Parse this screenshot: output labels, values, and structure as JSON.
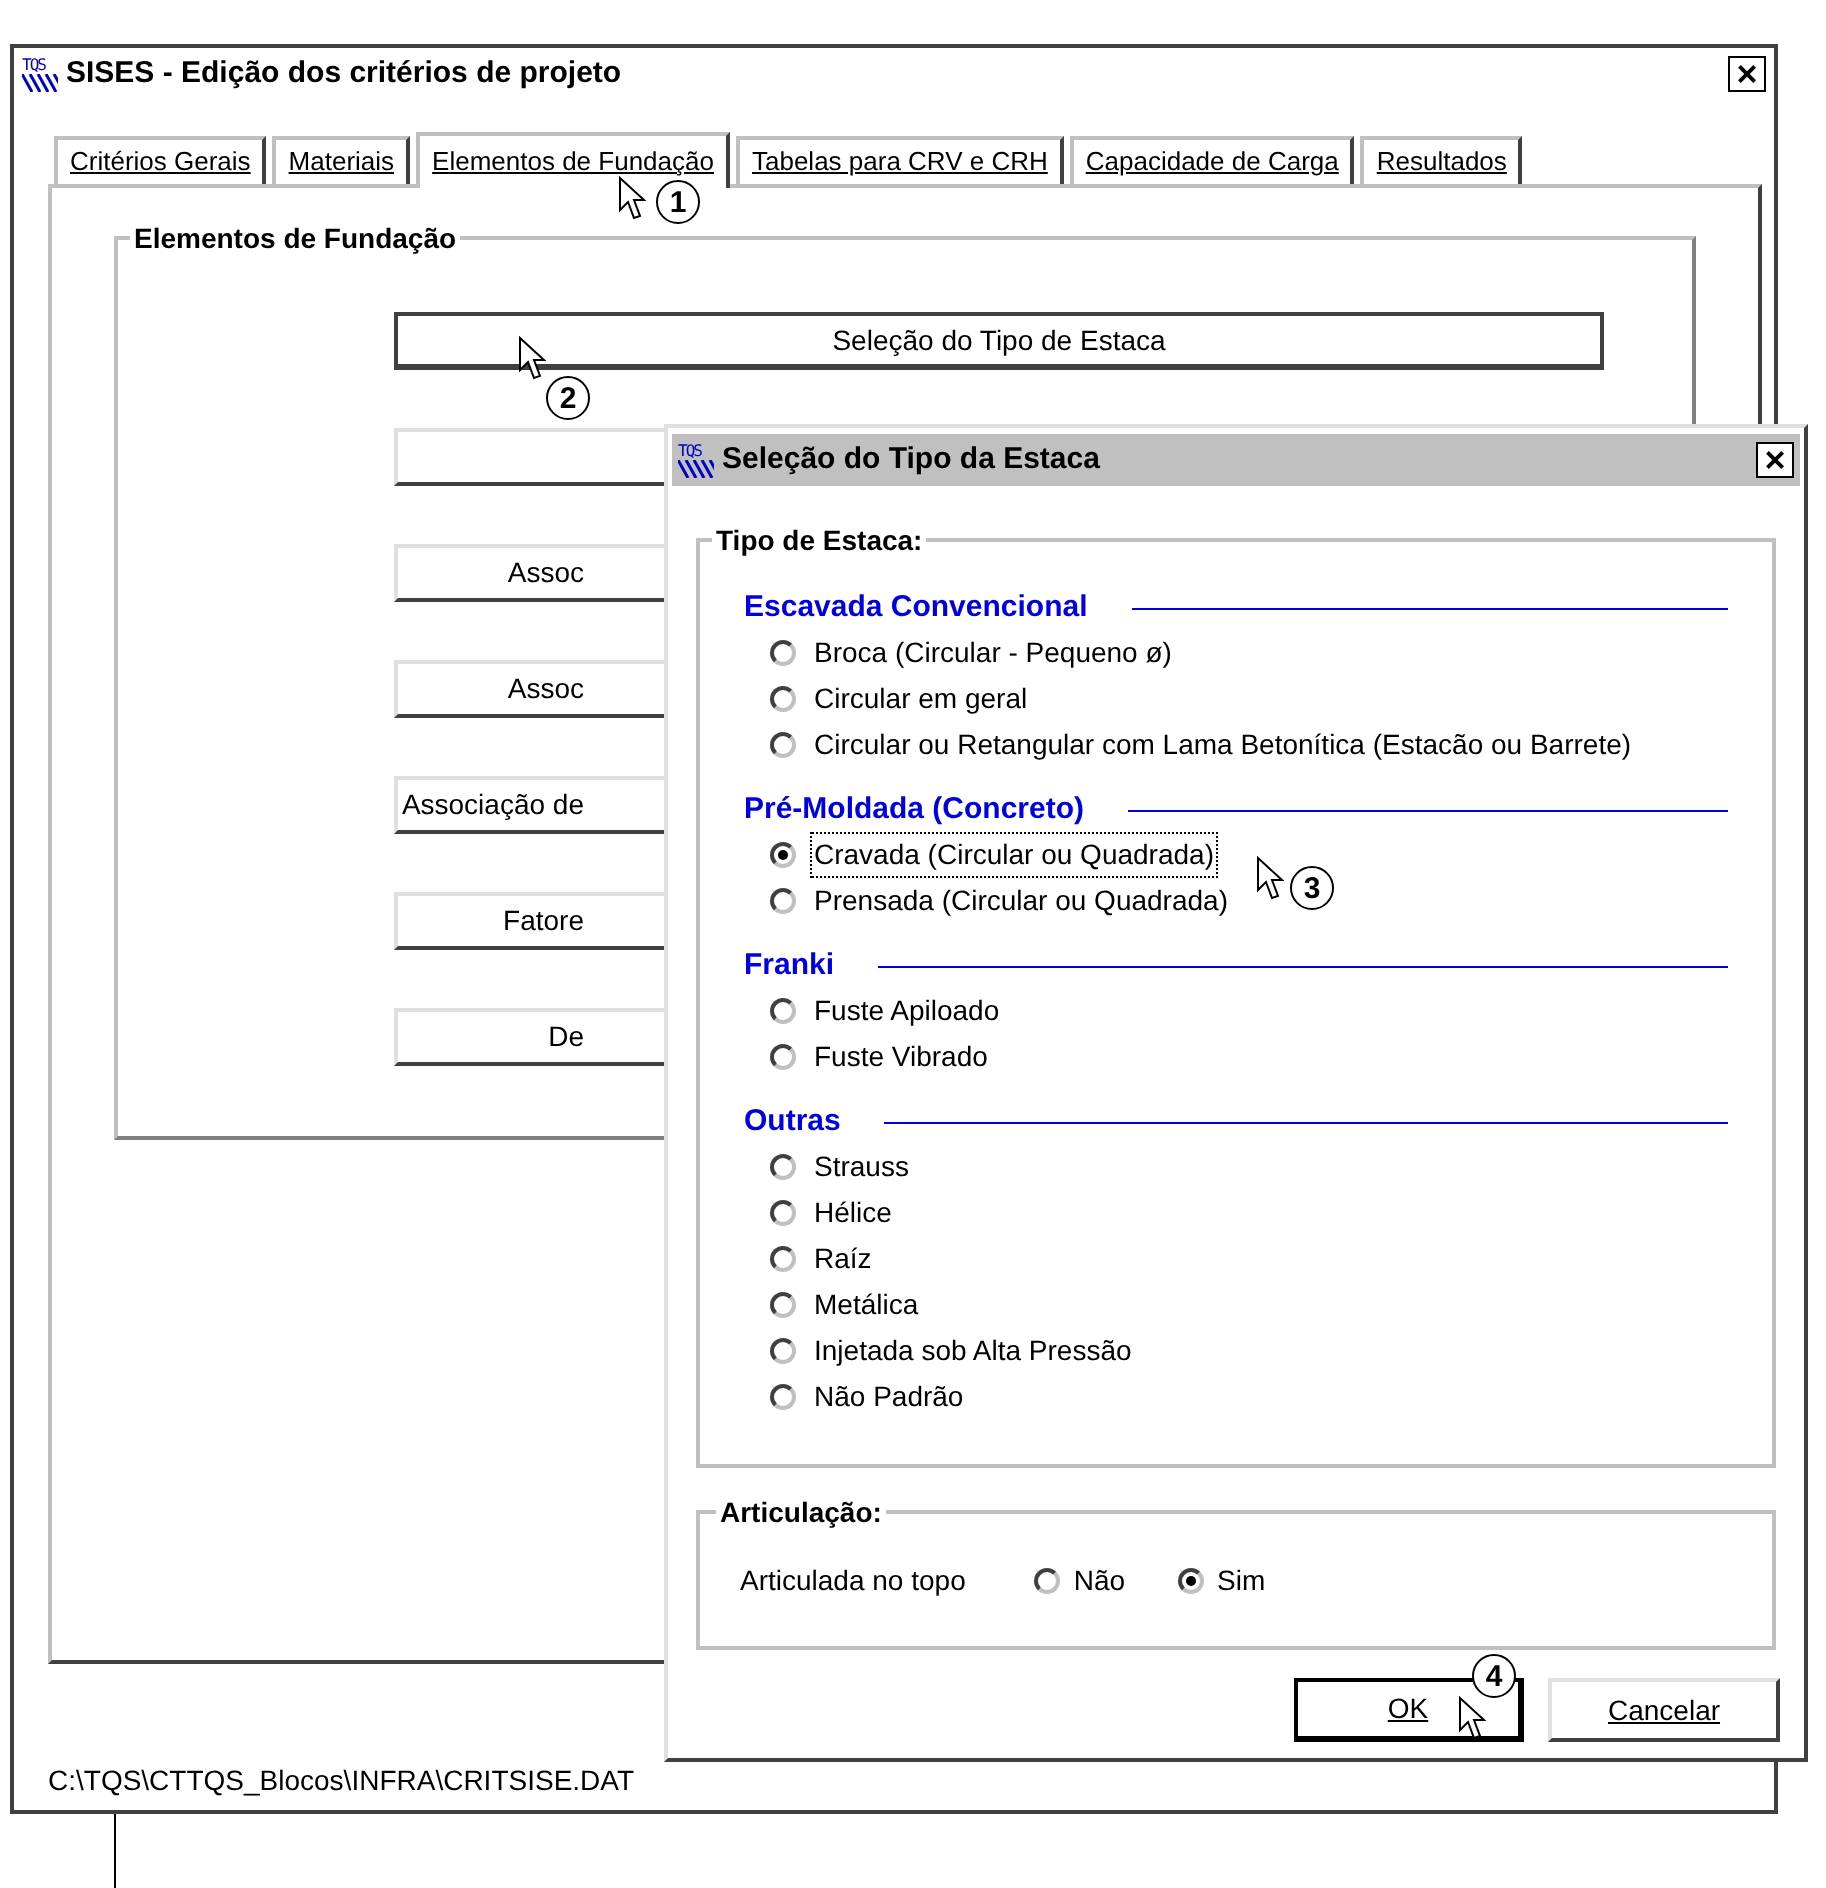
{
  "main_window": {
    "icon_text": "TQS",
    "title": "SISES - Edição dos critérios de projeto",
    "close": "×",
    "tabs": [
      {
        "label": "Critérios Gerais",
        "selected": false
      },
      {
        "label": "Materiais",
        "selected": false
      },
      {
        "label": "Elementos de Fundação",
        "selected": true
      },
      {
        "label": "Tabelas para CRV e CRH",
        "selected": false
      },
      {
        "label": "Capacidade de Carga",
        "selected": false
      },
      {
        "label": "Resultados",
        "selected": false
      }
    ],
    "group_title": "Elementos de Fundação",
    "buttons": [
      {
        "label": "Seleção do Tipo de Estaca",
        "default": true
      },
      {
        "default": false
      },
      {
        "label": "Assoc",
        "default": false
      },
      {
        "label": "Assoc",
        "default": false
      },
      {
        "label": "Associação de",
        "default": false
      },
      {
        "label": "Fatore",
        "default": false
      },
      {
        "label": "De",
        "default": false
      }
    ],
    "status_bar": "C:\\TQS\\CTTQS_Blocos\\INFRA\\CRITSISE.DAT"
  },
  "dialog": {
    "icon_text": "TQS",
    "title": "Seleção do Tipo da Estaca",
    "close": "×",
    "group_title": "Tipo de Estaca:",
    "sections": [
      {
        "heading": "Escavada Convencional",
        "options": [
          {
            "label": "Broca (Circular - Pequeno ø)",
            "selected": false,
            "focused": false
          },
          {
            "label": "Circular em geral",
            "selected": false,
            "focused": false
          },
          {
            "label": "Circular ou Retangular com Lama Betonítica (Estacão ou Barrete)",
            "selected": false,
            "focused": false
          }
        ]
      },
      {
        "heading": "Pré-Moldada (Concreto)",
        "options": [
          {
            "label": "Cravada (Circular ou Quadrada)",
            "selected": true,
            "focused": true
          },
          {
            "label": "Prensada (Circular ou Quadrada)",
            "selected": false,
            "focused": false
          }
        ]
      },
      {
        "heading": "Franki",
        "options": [
          {
            "label": "Fuste Apiloado",
            "selected": false,
            "focused": false
          },
          {
            "label": "Fuste Vibrado",
            "selected": false,
            "focused": false
          }
        ]
      },
      {
        "heading": "Outras",
        "options": [
          {
            "label": "Strauss",
            "selected": false,
            "focused": false
          },
          {
            "label": "Hélice",
            "selected": false,
            "focused": false
          },
          {
            "label": "Raíz",
            "selected": false,
            "focused": false
          },
          {
            "label": "Metálica",
            "selected": false,
            "focused": false
          },
          {
            "label": "Injetada sob Alta Pressão",
            "selected": false,
            "focused": false
          },
          {
            "label": "Não Padrão",
            "selected": false,
            "focused": false
          }
        ]
      }
    ],
    "articulation": {
      "group_title": "Articulação:",
      "label": "Articulada no topo",
      "options": [
        {
          "label": "Não",
          "selected": false
        },
        {
          "label": "Sim",
          "selected": true
        }
      ]
    },
    "buttons": [
      {
        "label": "OK",
        "default": true
      },
      {
        "label": "Cancelar",
        "default": false
      }
    ]
  },
  "callouts": [
    {
      "label": "1"
    },
    {
      "label": "2"
    },
    {
      "label": "3"
    },
    {
      "label": "4"
    }
  ]
}
